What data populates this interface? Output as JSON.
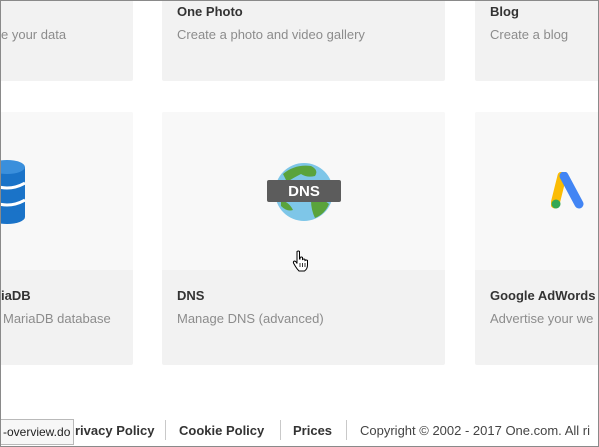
{
  "cards_top": [
    {
      "title": "",
      "desc": "e your data"
    },
    {
      "title": "One Photo",
      "desc": "Create a photo and video gallery"
    },
    {
      "title": "Blog",
      "desc": "Create a blog"
    }
  ],
  "cards_main": [
    {
      "title": "riaDB",
      "desc": "MariaDB database",
      "icon": "database-icon"
    },
    {
      "title": "DNS",
      "desc": "Manage DNS (advanced)",
      "icon": "dns-globe-icon",
      "badge": "DNS"
    },
    {
      "title": "Google AdWords",
      "desc": "Advertise your we",
      "icon": "google-adwords-icon"
    }
  ],
  "footer": {
    "links": [
      "rivacy Policy",
      "Cookie Policy",
      "Prices"
    ],
    "copyright": "Copyright © 2002 - 2017 One.com. All ri"
  },
  "status_tip": "-overview.do",
  "colors": {
    "card_bg": "#f2f2f2",
    "db_blue": "#1a73c8",
    "globe_green": "#5aa33c",
    "globe_ocean": "#7ec6e8",
    "badge": "#5c5c5c",
    "adwords_blue": "#4285f4",
    "adwords_yellow": "#fbbc04",
    "adwords_green": "#34a853"
  }
}
